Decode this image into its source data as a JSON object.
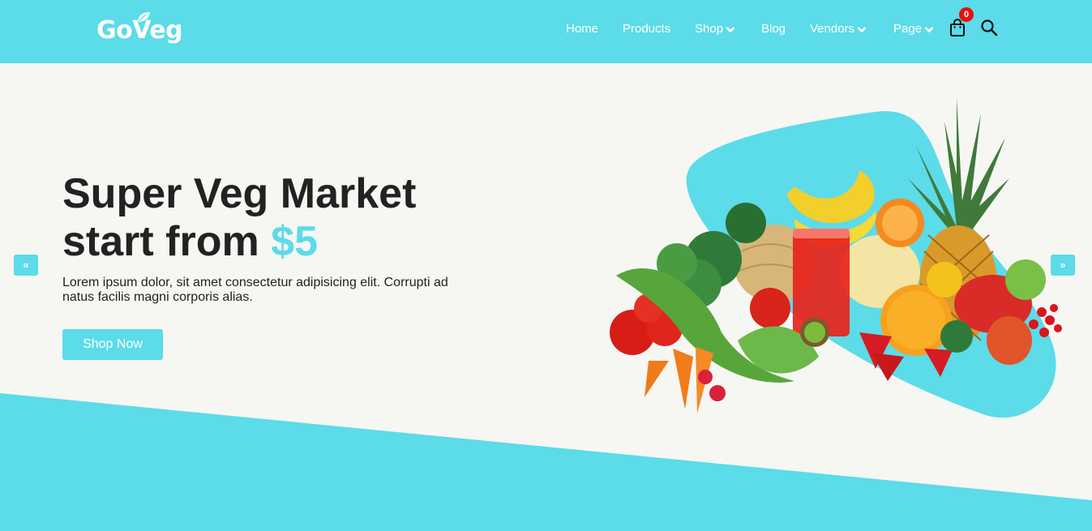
{
  "brand": {
    "name": "GoVeg"
  },
  "nav": {
    "items": [
      {
        "label": "Home",
        "dropdown": false
      },
      {
        "label": "Products",
        "dropdown": false
      },
      {
        "label": "Shop",
        "dropdown": true
      },
      {
        "label": "Blog",
        "dropdown": false
      },
      {
        "label": "Vendors",
        "dropdown": true
      },
      {
        "label": "Page",
        "dropdown": true
      }
    ],
    "cart_count": "0",
    "icons": [
      "shopping-bag-icon",
      "search-icon"
    ]
  },
  "hero": {
    "title_line1": "Super Veg Market",
    "title_line2": "start from",
    "title_price": "$5",
    "description": "Lorem ipsum dolor, sit amet consectetur adipisicing elit. Corrupti ad natus facilis magni corporis alias.",
    "cta_label": "Shop Now",
    "prev_label": "«",
    "next_label": "»"
  },
  "colors": {
    "accent": "#5cdbe9",
    "background": "#f6f7f3",
    "text": "#222222",
    "badge": "#e8100f"
  }
}
